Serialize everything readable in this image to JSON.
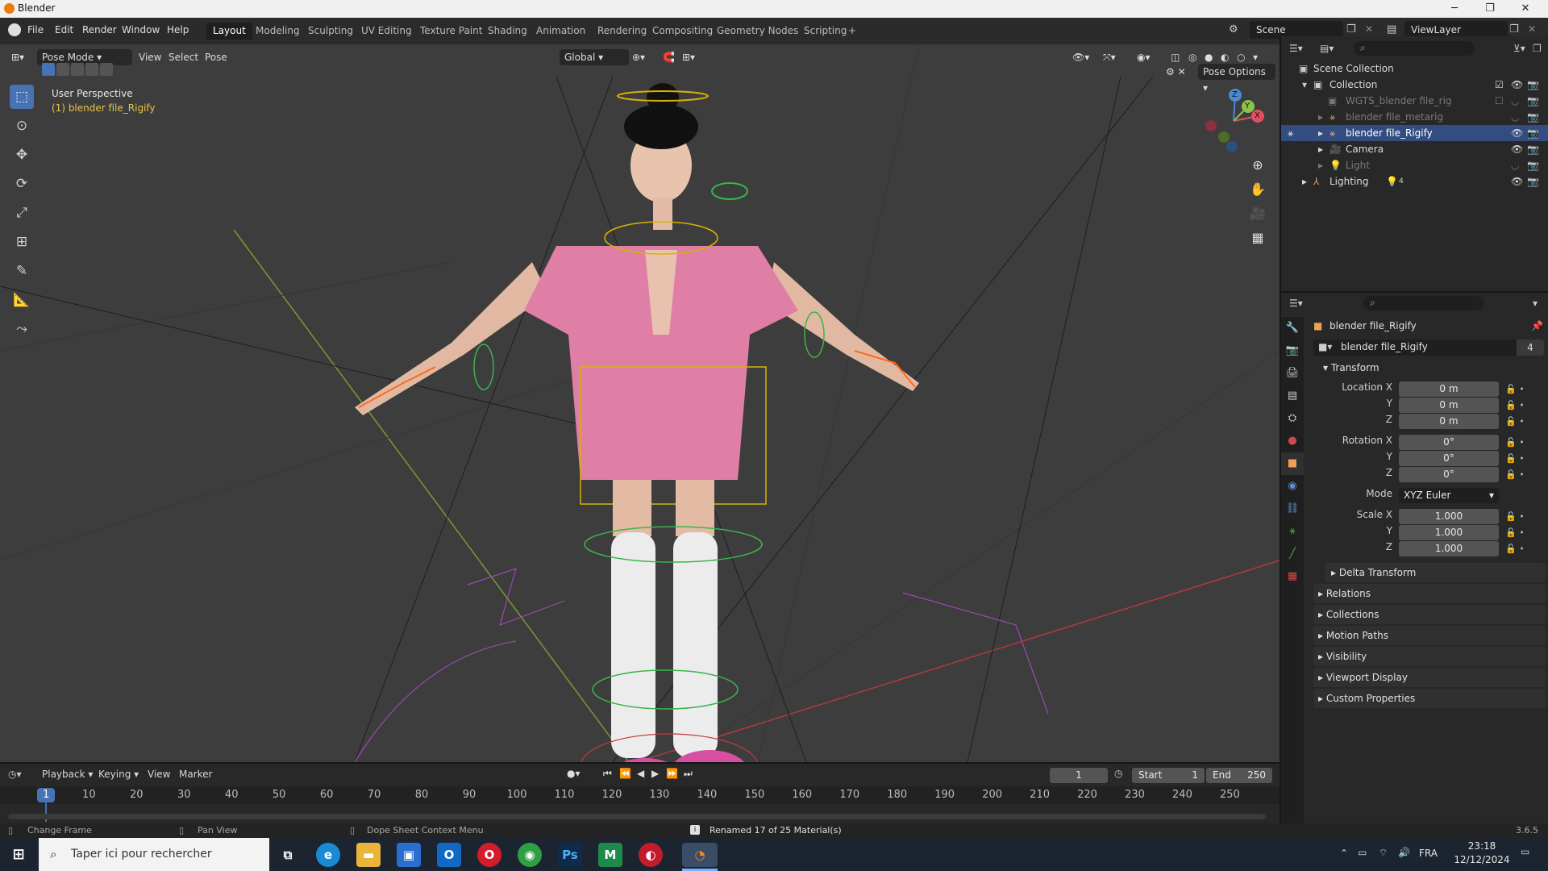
{
  "window": {
    "title": "Blender",
    "minimize": "─",
    "restore": "❐",
    "close": "✕"
  },
  "menu": [
    "File",
    "Edit",
    "Render",
    "Window",
    "Help"
  ],
  "workspaces": [
    "Layout",
    "Modeling",
    "Sculpting",
    "UV Editing",
    "Texture Paint",
    "Shading",
    "Animation",
    "Rendering",
    "Compositing",
    "Geometry Nodes",
    "Scripting"
  ],
  "add_workspace": "+",
  "scene": "Scene",
  "view_layer": "ViewLayer",
  "viewport": {
    "mode": "Pose Mode",
    "menus": [
      "View",
      "Select",
      "Pose"
    ],
    "orientation": "Global",
    "pose_options": "Pose Options",
    "overlay_title": "User Perspective",
    "overlay_object": "(1) blender file_Rigify",
    "gizmo": {
      "x": "X",
      "y": "Y",
      "z": "Z"
    }
  },
  "outliner": {
    "items": [
      {
        "label": "Scene Collection"
      },
      {
        "label": "Collection"
      },
      {
        "label": "WGTS_blender file_rig"
      },
      {
        "label": "blender file_metarig"
      },
      {
        "label": "blender file_Rigify"
      },
      {
        "label": "Camera"
      },
      {
        "label": "Light"
      },
      {
        "label": "Lighting"
      }
    ],
    "lighting_count": "4"
  },
  "properties": {
    "object_name": "blender file_Rigify",
    "data_name": "blender file_Rigify",
    "users": "4",
    "transform_label": "Transform",
    "location": {
      "label": "Location X",
      "x": "0 m",
      "y": "0 m",
      "z": "0 m"
    },
    "rotation": {
      "label": "Rotation X",
      "x": "0°",
      "y": "0°",
      "z": "0°"
    },
    "axis_y": "Y",
    "axis_z": "Z",
    "mode_label": "Mode",
    "mode_value": "XYZ Euler",
    "scale": {
      "label": "Scale X",
      "x": "1.000",
      "y": "1.000",
      "z": "1.000"
    },
    "panels": [
      "Delta Transform",
      "Relations",
      "Collections",
      "Motion Paths",
      "Visibility",
      "Viewport Display",
      "Custom Properties"
    ]
  },
  "timeline": {
    "menus": [
      "Playback",
      "Keying",
      "View",
      "Marker"
    ],
    "current_frame": "1",
    "start_label": "Start",
    "start": "1",
    "end_label": "End",
    "end": "250",
    "ticks": [
      "1",
      "10",
      "20",
      "30",
      "40",
      "50",
      "60",
      "70",
      "80",
      "90",
      "100",
      "110",
      "120",
      "130",
      "140",
      "150",
      "160",
      "170",
      "180",
      "190",
      "200",
      "210",
      "220",
      "230",
      "240",
      "250"
    ]
  },
  "status": {
    "change_frame": "Change Frame",
    "pan_view": "Pan View",
    "context_menu": "Dope Sheet Context Menu",
    "message": "Renamed 17 of 25 Material(s)",
    "version": "3.6.5"
  },
  "taskbar": {
    "search_placeholder": "Taper ici pour rechercher",
    "language": "FRA",
    "time": "23:18",
    "date": "12/12/2024"
  },
  "colors": {
    "accent": "#4772b3",
    "selection": "#334d80",
    "viewport": "#3d3d3d",
    "panel": "#282828"
  }
}
